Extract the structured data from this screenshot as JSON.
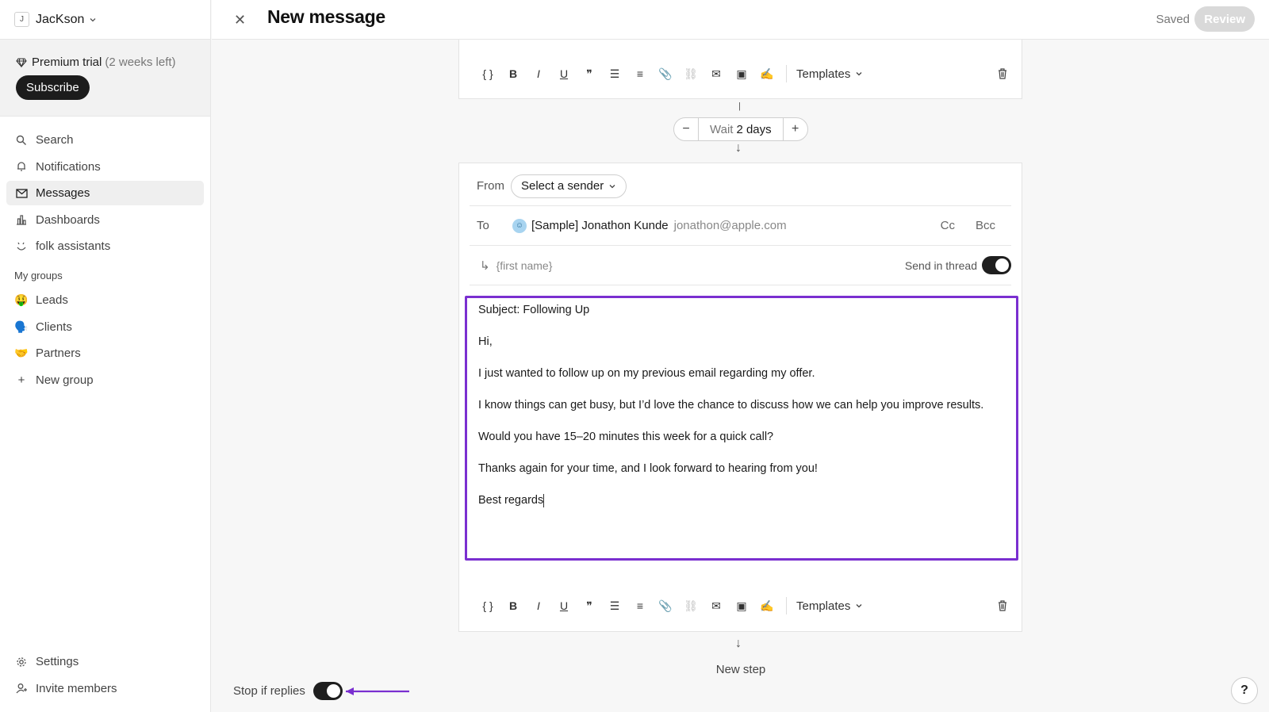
{
  "sidebar": {
    "workspace_initial": "J",
    "workspace_name": "JacKson",
    "trial_label": "Premium trial",
    "trial_remaining": "(2 weeks left)",
    "subscribe_label": "Subscribe",
    "nav": [
      {
        "label": "Search",
        "icon": "search-icon"
      },
      {
        "label": "Notifications",
        "icon": "bell-icon"
      },
      {
        "label": "Messages",
        "icon": "mail-icon",
        "active": true
      },
      {
        "label": "Dashboards",
        "icon": "chart-icon"
      },
      {
        "label": "folk assistants",
        "icon": "assistant-icon"
      }
    ],
    "groups_title": "My groups",
    "groups": [
      {
        "label": "Leads",
        "emoji": "🤑"
      },
      {
        "label": "Clients",
        "emoji": "🗣️"
      },
      {
        "label": "Partners",
        "emoji": "🤝"
      },
      {
        "label": "New group",
        "emoji": "+"
      }
    ],
    "bottom": [
      {
        "label": "Settings",
        "icon": "gear-icon"
      },
      {
        "label": "Invite members",
        "icon": "add-user-icon"
      }
    ]
  },
  "header": {
    "title": "New message",
    "status": "Saved",
    "review_label": "Review"
  },
  "toolbar": {
    "templates_label": "Templates"
  },
  "wait": {
    "prefix": "Wait",
    "value": "2 days"
  },
  "email": {
    "from_label": "From",
    "sender_placeholder": "Select a sender",
    "to_label": "To",
    "recipient_name": "[Sample] Jonathon Kunde",
    "recipient_email": "jonathon@apple.com",
    "cc_label": "Cc",
    "bcc_label": "Bcc",
    "subject_placeholder": "{first name}",
    "thread_label": "Send in thread",
    "body": {
      "subject_line": "Subject: Following Up",
      "greeting": "Hi,",
      "p1": "I just wanted to follow up on my previous email regarding my offer.",
      "p2": "I know things can get busy, but I’d love the chance to discuss how we can help you improve results.",
      "p3": "Would you have 15–20 minutes this week for a quick call?",
      "p4": "Thanks again for your time, and I look forward to hearing from you!",
      "signoff": "Best regards"
    }
  },
  "new_step_label": "New step",
  "stop_label": "Stop if replies",
  "help_label": "?",
  "accent_color": "#7a2fd0"
}
